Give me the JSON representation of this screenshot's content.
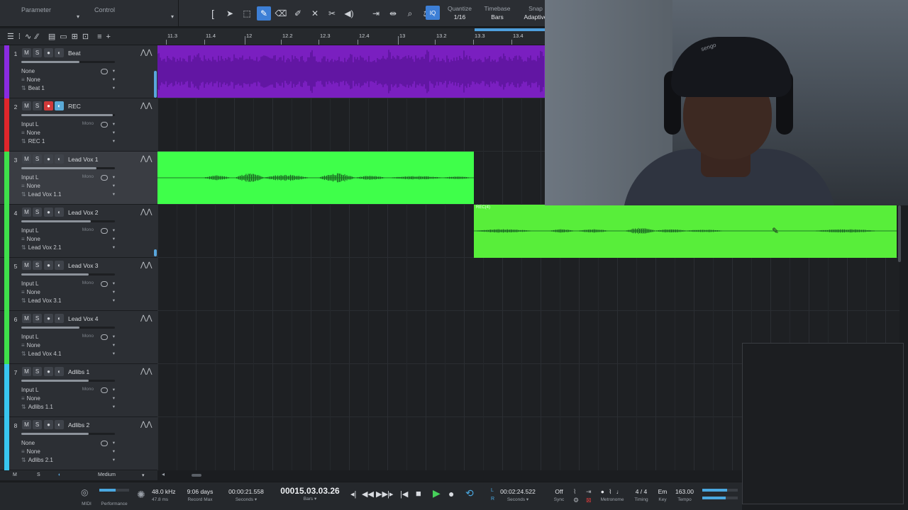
{
  "toolbar": {
    "parameter_label": "Parameter",
    "control_label": "Control",
    "tools": [
      "arrow-icon",
      "range-icon",
      "pencil-icon",
      "eraser-icon",
      "paint-icon",
      "mute-tool-icon",
      "split-icon",
      "listen-icon",
      "bend-icon",
      "audio-bend-icon",
      "zoom-icon",
      "mixer-tool-icon"
    ],
    "iq_label": "IQ",
    "quantize_label": "Quantize",
    "quantize_value": "1/16",
    "timebase_label": "Timebase",
    "timebase_value": "Bars",
    "snap_label": "Snap",
    "snap_value": "Adaptive"
  },
  "ruler": {
    "labels": [
      "11.3",
      "11.4",
      "12",
      "12.2",
      "12.3",
      "12.4",
      "13",
      "13.2",
      "13.3",
      "13.4"
    ]
  },
  "tracks": [
    {
      "num": "1",
      "name": "Beat",
      "color": "#8a2be2",
      "input": "None",
      "route": "None",
      "clip": "Beat 1",
      "mono": "",
      "rec": false,
      "mon": false,
      "fader": 0.62
    },
    {
      "num": "2",
      "name": "REC",
      "color": "#e0262b",
      "input": "Input L",
      "route": "None",
      "clip": "REC 1",
      "mono": "Mono",
      "rec": true,
      "mon": true,
      "fader": 0.98
    },
    {
      "num": "3",
      "name": "Lead Vox 1",
      "color": "#3ee04a",
      "input": "Input L",
      "route": "None",
      "clip": "Lead Vox 1.1",
      "mono": "Mono",
      "rec": false,
      "mon": false,
      "fader": 0.8
    },
    {
      "num": "4",
      "name": "Lead Vox 2",
      "color": "#3ee04a",
      "input": "Input L",
      "route": "None",
      "clip": "Lead Vox 2.1",
      "mono": "Mono",
      "rec": false,
      "mon": false,
      "fader": 0.74
    },
    {
      "num": "5",
      "name": "Lead Vox 3",
      "color": "#3ee04a",
      "input": "Input L",
      "route": "None",
      "clip": "Lead Vox 3.1",
      "mono": "Mono",
      "rec": false,
      "mon": false,
      "fader": 0.72
    },
    {
      "num": "6",
      "name": "Lead Vox 4",
      "color": "#3ee04a",
      "input": "Input L",
      "route": "None",
      "clip": "Lead Vox 4.1",
      "mono": "Mono",
      "rec": false,
      "mon": false,
      "fader": 0.62
    },
    {
      "num": "7",
      "name": "Adlibs 1",
      "color": "#38c6f0",
      "input": "Input L",
      "route": "None",
      "clip": "Adlibs 1.1",
      "mono": "Mono",
      "rec": false,
      "mon": false,
      "fader": 0.72
    },
    {
      "num": "8",
      "name": "Adlibs 2",
      "color": "#38c6f0",
      "input": "None",
      "route": "None",
      "clip": "Adlibs 2.1",
      "mono": "",
      "rec": false,
      "mon": false,
      "fader": 0.72
    }
  ],
  "clips": {
    "rec_label": "REC(4)"
  },
  "status": {
    "m_label": "M",
    "s_label": "S",
    "size_label": "Medium"
  },
  "transport": {
    "midi_label": "MIDI",
    "performance_label": "Performance",
    "sample_rate": "48.0 kHz",
    "latency": "47.8 ms",
    "record_days": "9:06 days",
    "record_max_label": "Record Max",
    "time_seconds": "00:00:21.558",
    "seconds_label": "Seconds",
    "bars_position": "00015.03.03.26",
    "bars_label": "Bars",
    "loop_time": "00:02:24.522",
    "loop_seconds_label": "Seconds",
    "sync_value": "Off",
    "sync_label": "Sync",
    "metronome_label": "Metronome",
    "timing_value": "4 / 4",
    "timing_label": "Timing",
    "key_value": "Em",
    "key_label": "Key",
    "tempo_value": "163.00",
    "tempo_label": "Tempo",
    "cpu_fraction": 0.55
  },
  "webcam": {
    "brand_text": "sengo"
  }
}
